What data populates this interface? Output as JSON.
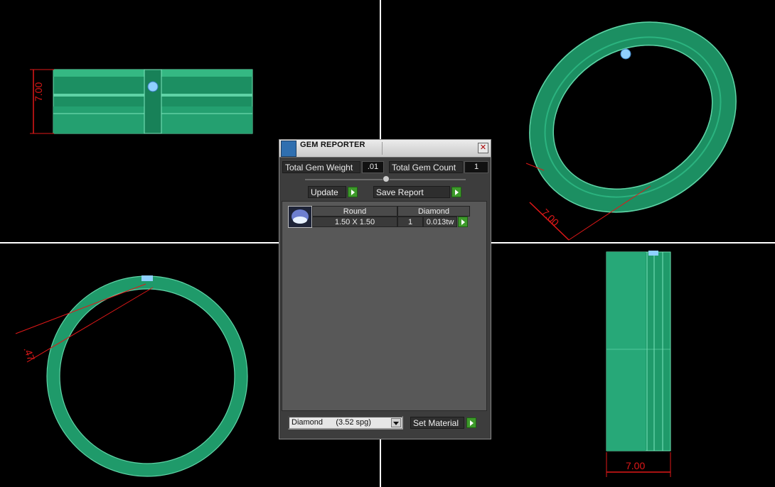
{
  "viewports": {
    "front_dimension": "7.00",
    "perspective_dimension": "7.00",
    "side_dimension": "7.00",
    "top_dimension": ".47"
  },
  "colors": {
    "ring": "#1f9a6a",
    "ring_light": "#5fd3a6",
    "dimension": "#e01818",
    "gem": "#7fc8ff"
  },
  "gem_reporter": {
    "title": "GEM REPORTER",
    "close_icon": "close-icon",
    "total_gem_weight_label": "Total Gem Weight",
    "total_gem_weight_value": ".01",
    "total_gem_count_label": "Total Gem Count",
    "total_gem_count_value": "1",
    "update_label": "Update",
    "save_report_label": "Save Report",
    "gem_row": {
      "shape": "Round",
      "material": "Diamond",
      "size": "1.50 X 1.50",
      "count": "1",
      "weight": "0.013tw"
    },
    "material_select": "Diamond      (3.52 spg)",
    "set_material_label": "Set Material"
  }
}
